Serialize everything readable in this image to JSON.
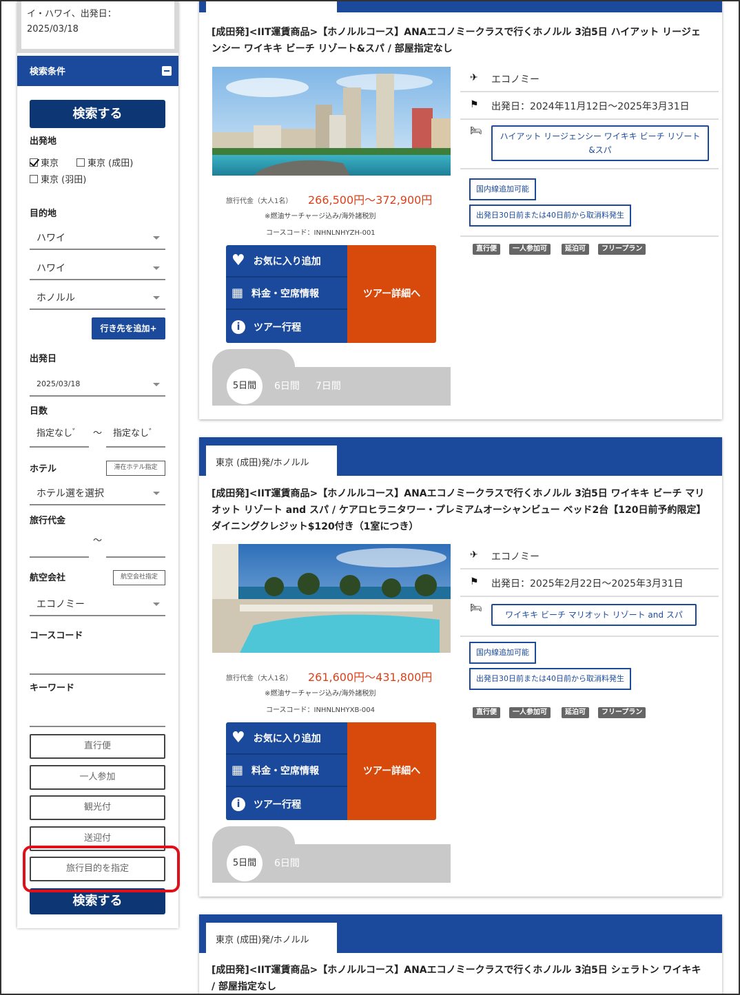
{
  "sidebar": {
    "summary_lines": [
      "イ・ハワイ、出発日：",
      "2025/03/18"
    ],
    "conditions_title": "検索条件",
    "search_label": "検索する",
    "departure": {
      "label": "出発地",
      "options": [
        {
          "label": "東京",
          "checked": true
        },
        {
          "label": "東京 (成田)",
          "checked": false
        },
        {
          "label": "東京 (羽田)",
          "checked": false
        }
      ]
    },
    "destination": {
      "label": "目的地",
      "selects": [
        "ハワイ",
        "ハワイ",
        "ホノルル"
      ],
      "add_label": "行き先を追加+"
    },
    "date": {
      "label": "出発日",
      "value": "2025/03/18"
    },
    "days": {
      "label": "日数",
      "from": "指定なしﾞ",
      "sep": "〜",
      "to": "指定なしﾞ"
    },
    "hotel": {
      "label": "ホテル",
      "button": "滞在ホテル指定",
      "select": "ホテル選を選択"
    },
    "price": {
      "label": "旅行代金",
      "sep": "〜"
    },
    "airline": {
      "label": "航空会社",
      "button": "航空会社指定",
      "select": "エコノミー"
    },
    "course_code": {
      "label": "コースコード"
    },
    "keyword": {
      "label": "キーワード"
    },
    "option_buttons": [
      "直行便",
      "一人参加",
      "観光付",
      "送迎付",
      "旅行目的を指定"
    ],
    "search_bottom_label": "検索する"
  },
  "cards": [
    {
      "tab": "",
      "title": "[成田発]<IIT運賃商品>【ホノルルコース】ANAエコノミークラスで行くホノルル 3泊5日 ハイアット リージェンシー ワイキキ ビーチ リゾート&スパ / 部屋指定なし",
      "price_label": "旅行代金（大人1名）",
      "price": "266,500円〜372,900円",
      "surcharge_note": "※燃油サーチャージ込み/海外諸税別",
      "course_code": "コースコード：INHNLNHYZH-001",
      "actions": {
        "favorite": "お気に入り追加",
        "rates": "料金・空席情報",
        "itinerary": "ツアー行程",
        "detail": "ツアー詳細へ"
      },
      "days": [
        "5日間",
        "6日間",
        "7日間"
      ],
      "cabin": "エコノミー",
      "departure_period": "出発日：2024年11月12日〜2025年3月31日",
      "hotel": "ハイアット リージェンシー ワイキキ ビーチ リゾート&スパ",
      "tags_outline": [
        "国内線追加可能",
        "出発日30日前または40日前から取消料発生"
      ],
      "tags_grey": [
        "直行便",
        "一人参加可",
        "延泊可",
        "フリープラン"
      ]
    },
    {
      "tab": "東京 (成田)発/ホノルル",
      "title": "[成田発]<IIT運賃商品>【ホノルルコース】ANAエコノミークラスで行くホノルル 3泊5日 ワイキキ ビーチ マリオット リゾート and スパ / ケアロヒラニタワー・プレミアムオーシャンビュー ベッド2台【120日前予約限定】ダイニングクレジット$120付き（1室につき）",
      "price_label": "旅行代金（大人1名）",
      "price": "261,600円〜431,800円",
      "surcharge_note": "※燃油サーチャージ込み/海外諸税別",
      "course_code": "コースコード：INHNLNHYXB-004",
      "actions": {
        "favorite": "お気に入り追加",
        "rates": "料金・空席情報",
        "itinerary": "ツアー行程",
        "detail": "ツアー詳細へ"
      },
      "days": [
        "5日間",
        "6日間"
      ],
      "cabin": "エコノミー",
      "departure_period": "出発日：2025年2月22日〜2025年3月31日",
      "hotel": "ワイキキ ビーチ マリオット リゾート and スパ",
      "tags_outline": [
        "国内線追加可能",
        "出発日30日前または40日前から取消料発生"
      ],
      "tags_grey": [
        "直行便",
        "一人参加可",
        "延泊可",
        "フリープラン"
      ]
    },
    {
      "tab": "東京 (成田)発/ホノルル",
      "title": "[成田発]<IIT運賃商品>【ホノルルコース】ANAエコノミークラスで行くホノルル 3泊5日 シェラトン ワイキキ / 部屋指定なし"
    }
  ],
  "colors": {
    "brand_blue": "#1b4a9c",
    "navy": "#0d3675",
    "accent_orange": "#d84a0c",
    "price_red": "#d9421a",
    "highlight_red": "#e0101a"
  }
}
